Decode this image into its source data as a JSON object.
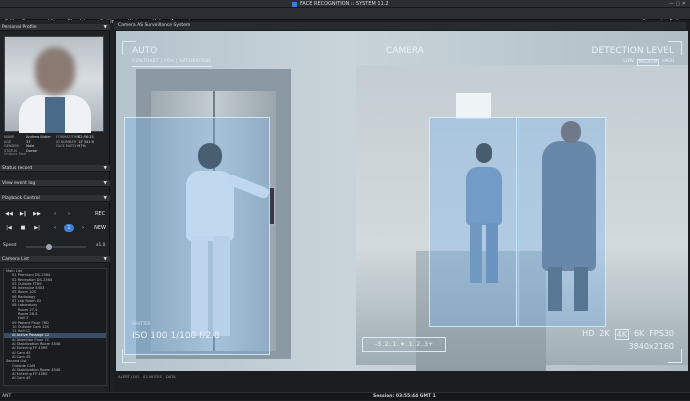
{
  "window": {
    "title": "FACE RECOGNITION :: SYSTEM 11.2",
    "controls": "—  ▢  ✕"
  },
  "menu": {
    "left": [
      "Edit",
      "Camera",
      "View",
      "Check Log",
      "Settings",
      "History",
      "Help",
      "Account"
    ],
    "right": [
      "Account",
      "Exit"
    ]
  },
  "left": {
    "personal_profile": "Personal Profile",
    "profile_fields": [
      [
        "NAME",
        "Andrew Butler"
      ],
      [
        "AGE",
        "33"
      ],
      [
        "GENDER",
        "Male"
      ],
      [
        "STATUS",
        "Doctor"
      ]
    ],
    "profile_fields2": [
      [
        "FORMAT/TIME",
        "02:56:25"
      ],
      [
        "ID NUMBER",
        "1Z 341 8"
      ],
      [
        "FACE MATCH",
        "97%"
      ]
    ],
    "undone_text": "Undone Med",
    "row1": "Status record",
    "row2": "View event log",
    "playback": "Playback Control",
    "rec": "REC",
    "new": "NEW",
    "speed_label": "Speed",
    "speed_value": "x1.0",
    "camera_list": "Camera List",
    "tree": [
      "Main List",
      "01 Premium DS-2564",
      "02 Reception DS-2564",
      "03 Outside FT89",
      "04 Intensive 5403",
      "05 Room 10S",
      "06 Radiology",
      "07 Lab Room 02",
      "08 Laboratory",
      "Room 27-5",
      "Room 28-5",
      "Hall 3",
      "09 Patient Floor 78D",
      "10 Outside Cam 12S",
      "11 Hall 12",
      "AI Active Passage 12",
      "AI Attention Floor 7C",
      "AI Stabilization Room 4548",
      "AI Entering FF 45RE",
      "AI Cam 45",
      "AI Cam 45",
      "Second List",
      "Outside CAM",
      "AI Stabilization Room 4548",
      "AI Entering FF 45RE",
      "AI Cam 45"
    ],
    "tree_selected": 15
  },
  "camera": {
    "window_title": "Camera AS Surveillance System",
    "auto": "AUTO",
    "modes": "CONTRAST  |  FOV  |  SATURATION",
    "camera_label": "CAMERA",
    "detection": "DETECTION LEVEL",
    "levels": [
      "LOW",
      "MEDIUM",
      "HIGH"
    ],
    "selected_level": "MEDIUM",
    "iso": "ISO 100 1/100 f/2.8",
    "iso_small": "SHUTTER",
    "exposure": "-3..2..1..✦..1..2..3+",
    "res_modes": [
      "HD",
      "2K",
      "4K",
      "6K"
    ],
    "res_selected": "4K",
    "fps": "FPS30",
    "res": "3840x2160"
  },
  "status": {
    "session": "Session: 03:55:44 GMT 1",
    "left": "ANT",
    "small": [
      "ALERT LOG",
      "02 NOTES",
      "DATA"
    ]
  },
  "colors": {
    "accent": "#3d7fd6",
    "detection_box": "#7ab4eb",
    "hud": "#e8f2fa"
  }
}
